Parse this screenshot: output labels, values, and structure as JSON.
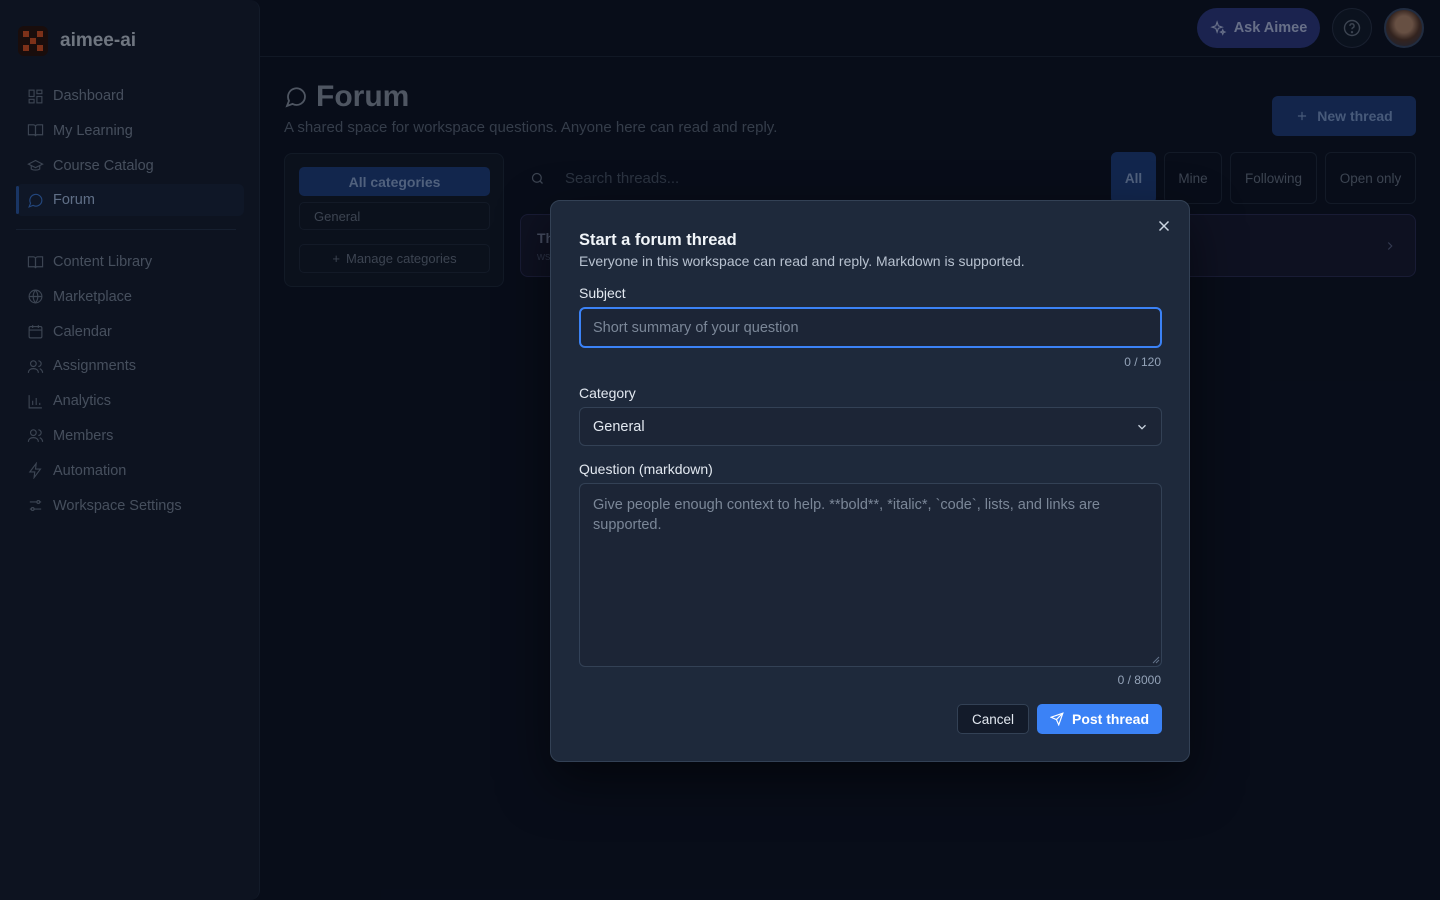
{
  "app": {
    "name": "aimee-ai"
  },
  "sidebar": {
    "items": [
      {
        "label": "Dashboard",
        "icon": "dashboard-icon"
      },
      {
        "label": "My Learning",
        "icon": "book-open-icon"
      },
      {
        "label": "Course Catalog",
        "icon": "graduation-cap-icon"
      },
      {
        "label": "Forum",
        "icon": "chat-bubble-icon",
        "active": true
      }
    ],
    "items2": [
      {
        "label": "Content Library",
        "icon": "book-icon"
      },
      {
        "label": "Marketplace",
        "icon": "globe-icon"
      },
      {
        "label": "Calendar",
        "icon": "calendar-icon"
      },
      {
        "label": "Assignments",
        "icon": "users-icon"
      },
      {
        "label": "Analytics",
        "icon": "bar-chart-icon"
      },
      {
        "label": "Members",
        "icon": "members-icon"
      },
      {
        "label": "Automation",
        "icon": "lightning-icon"
      },
      {
        "label": "Workspace Settings",
        "icon": "sliders-icon"
      }
    ]
  },
  "topbar": {
    "ask_label": "Ask Aimee"
  },
  "page": {
    "title": "Forum",
    "subtitle": "A shared space for workspace questions. Anyone here can read and reply.",
    "new_thread_label": "New thread"
  },
  "categories": {
    "all_label": "All categories",
    "general_label": "General",
    "manage_label": "Manage categories"
  },
  "search": {
    "placeholder": "Search threads..."
  },
  "filters": {
    "all": "All",
    "mine": "Mine",
    "following": "Following",
    "open_only": "Open only"
  },
  "thread_preview": {
    "title_fragment": "Th",
    "meta_fragment": "ws"
  },
  "modal": {
    "title": "Start a forum thread",
    "description": "Everyone in this workspace can read and reply. Markdown is supported.",
    "subject_label": "Subject",
    "subject_placeholder": "Short summary of your question",
    "subject_value": "",
    "subject_counter": "0 / 120",
    "category_label": "Category",
    "category_value": "General",
    "question_label": "Question (markdown)",
    "question_placeholder": "Give people enough context to help. **bold**, *italic*, `code`, lists, and links are supported.",
    "question_value": "",
    "question_counter": "0 / 8000",
    "cancel_label": "Cancel",
    "post_label": "Post thread"
  },
  "colors": {
    "accent": "#3b82f6",
    "background": "#0b1120",
    "modal_bg": "#1e293b",
    "brand_orange": "#e0521f"
  }
}
